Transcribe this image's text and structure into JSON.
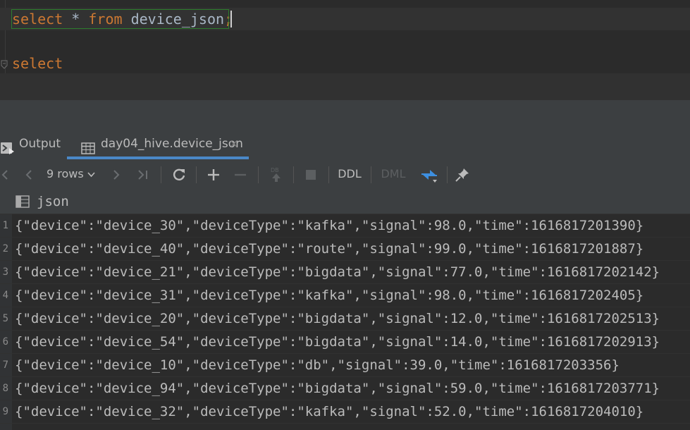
{
  "editor": {
    "line1": {
      "kw1": "select",
      "op": " * ",
      "kw2": "from",
      "ident": " device_json",
      "semi": ";"
    },
    "line2": {
      "kw1": "select"
    }
  },
  "tabs": {
    "output_label": "Output",
    "table_label": "day04_hive.device_json",
    "close_glyph": "×"
  },
  "toolbar": {
    "rows_label": "9 rows",
    "ddl_label": "DDL",
    "dml_label": "DML"
  },
  "grid": {
    "column_header": "json",
    "rows": [
      {
        "num": "1",
        "value": "{\"device\":\"device_30\",\"deviceType\":\"kafka\",\"signal\":98.0,\"time\":1616817201390}"
      },
      {
        "num": "2",
        "value": "{\"device\":\"device_40\",\"deviceType\":\"route\",\"signal\":99.0,\"time\":1616817201887}"
      },
      {
        "num": "3",
        "value": "{\"device\":\"device_21\",\"deviceType\":\"bigdata\",\"signal\":77.0,\"time\":1616817202142}"
      },
      {
        "num": "4",
        "value": "{\"device\":\"device_31\",\"deviceType\":\"kafka\",\"signal\":98.0,\"time\":1616817202405}"
      },
      {
        "num": "5",
        "value": "{\"device\":\"device_20\",\"deviceType\":\"bigdata\",\"signal\":12.0,\"time\":1616817202513}"
      },
      {
        "num": "6",
        "value": "{\"device\":\"device_54\",\"deviceType\":\"bigdata\",\"signal\":14.0,\"time\":1616817202913}"
      },
      {
        "num": "7",
        "value": "{\"device\":\"device_10\",\"deviceType\":\"db\",\"signal\":39.0,\"time\":1616817203356}"
      },
      {
        "num": "8",
        "value": "{\"device\":\"device_94\",\"deviceType\":\"bigdata\",\"signal\":59.0,\"time\":1616817203771}"
      },
      {
        "num": "9",
        "value": "{\"device\":\"device_32\",\"deviceType\":\"kafka\",\"signal\":52.0,\"time\":1616817204010}"
      }
    ]
  },
  "icons": {
    "output": "console-output-icon",
    "table": "table-icon",
    "refresh": "refresh-icon",
    "add": "add-row-icon",
    "remove": "remove-row-icon",
    "submit": "db-submit-icon",
    "stop": "stop-icon",
    "compare": "compare-icon",
    "pin": "pin-icon",
    "column": "column-icon"
  },
  "colors": {
    "keyword": "#cc7832",
    "text": "#a9b7c6",
    "accent": "#4a88c7",
    "statement_border": "#2d7d2d"
  }
}
